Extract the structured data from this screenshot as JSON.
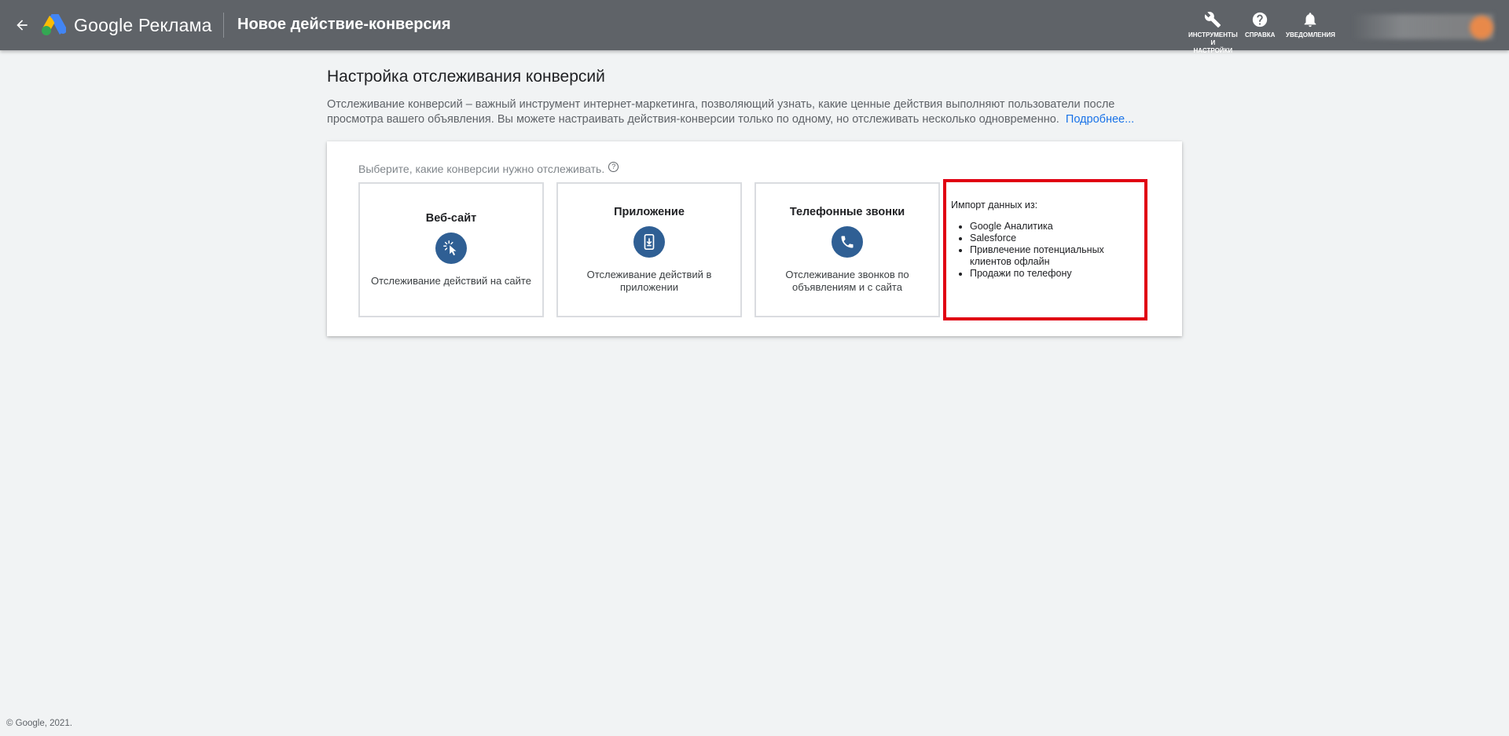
{
  "header": {
    "brand": "Google Реклама",
    "page_title": "Новое действие-конверсия",
    "actions": {
      "tools_line1": "ИНСТРУМЕНТЫ",
      "tools_line2": "И",
      "tools_line3": "НАСТРОЙКИ",
      "help": "СПРАВКА",
      "notifications": "УВЕДОМЛЕНИЯ"
    }
  },
  "main": {
    "title": "Настройка отслеживания конверсий",
    "intro_line1": "Отслеживание конверсий – важный инструмент интернет-маркетинга, позволяющий узнать, какие ценные действия выполняют пользователи после",
    "intro_line2": "просмотра вашего объявления. Вы можете настраивать действия-конверсии только по одному, но отслеживать несколько одновременно.",
    "learn_more": "Подробнее..."
  },
  "card": {
    "choose_label": "Выберите, какие конверсии нужно отслеживать.",
    "help_glyph": "?",
    "options": [
      {
        "title": "Веб-сайт",
        "desc": "Отслеживание действий на сайте",
        "icon": "cursor-click-icon"
      },
      {
        "title": "Приложение",
        "desc": "Отслеживание действий в приложении",
        "icon": "phone-download-icon"
      },
      {
        "title": "Телефонные звонки",
        "desc": "Отслеживание звонков по объявлениям и с сайта",
        "icon": "phone-call-icon"
      }
    ],
    "import": {
      "title": "Импорт данных из:",
      "items": [
        "Google Аналитика",
        "Salesforce",
        "Привлечение потенциальных клиентов офлайн",
        "Продажи по телефону"
      ]
    }
  },
  "footer": {
    "copyright": "© Google, 2021."
  },
  "colors": {
    "topbar": "#5f6368",
    "accent": "#2f5f94",
    "link": "#1a73e8",
    "highlight": "#e00012"
  }
}
